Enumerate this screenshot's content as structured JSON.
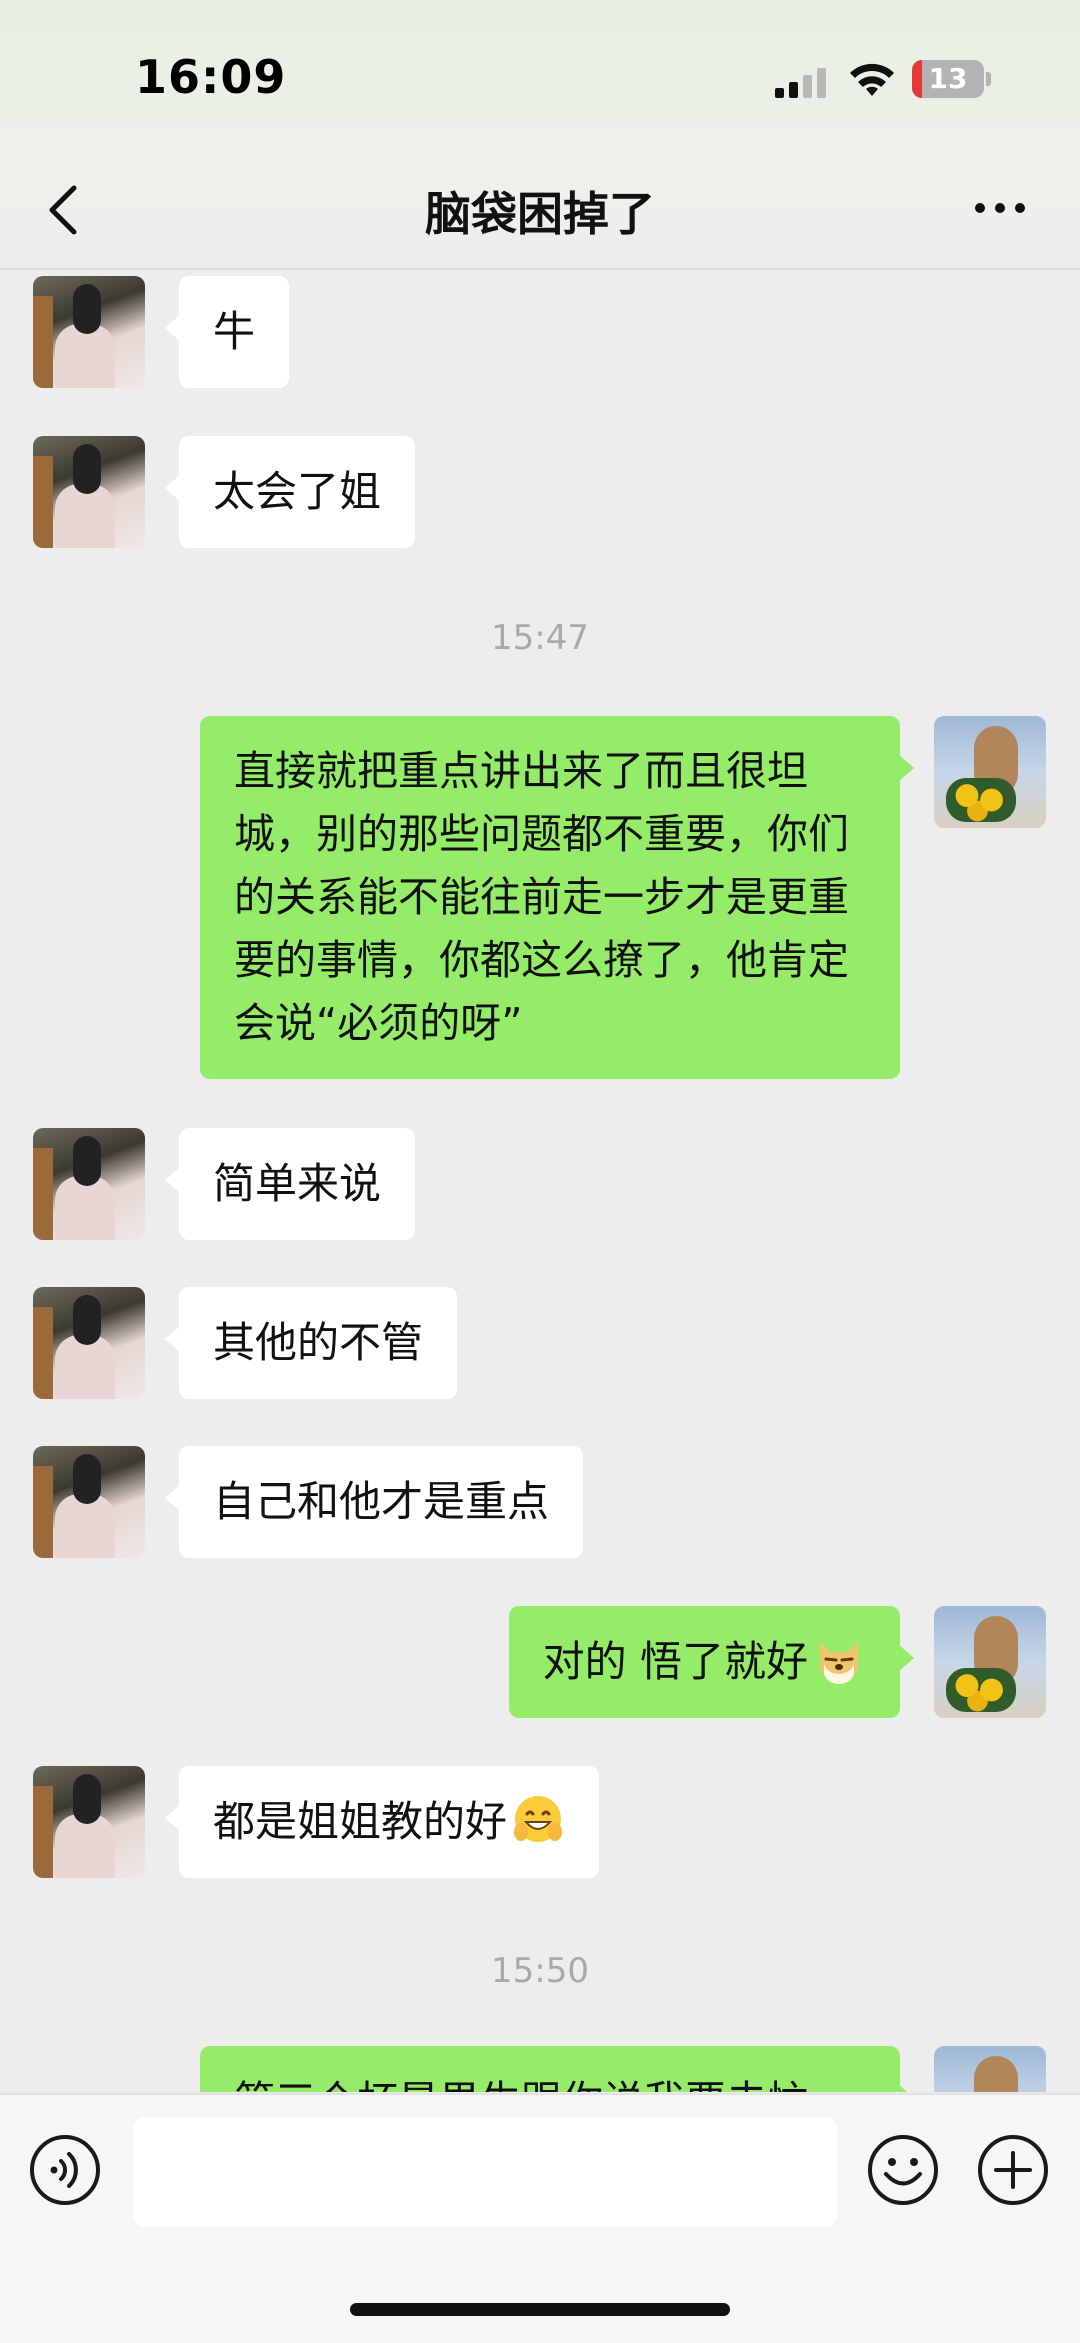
{
  "status_bar": {
    "time": "16:09",
    "battery_level": "13",
    "battery_color": "#e53935"
  },
  "header": {
    "title": "脑袋困掉了",
    "back_icon": "chevron-left-icon",
    "more_icon": "ellipsis-icon"
  },
  "messages": [
    {
      "side": "in",
      "text": "牛"
    },
    {
      "side": "in",
      "text": "太会了姐"
    },
    {
      "time": "15:47"
    },
    {
      "side": "out",
      "text": "直接就把重点讲出来了而且很坦城，别的那些问题都不重要，你们的关系能不能往前走一步才是更重要的事情，你都这么撩了，他肯定会说“必须的呀”"
    },
    {
      "side": "in",
      "text": "简单来说"
    },
    {
      "side": "in",
      "text": "其他的不管"
    },
    {
      "side": "in",
      "text": "自己和他才是重点"
    },
    {
      "side": "out",
      "text": "对的 悟了就好",
      "emoji": "doge-emoji"
    },
    {
      "side": "in",
      "text": "都是姐姐教的好",
      "emoji": "grin-emoji"
    },
    {
      "time": "15:50"
    },
    {
      "side": "out",
      "text": "第三个杯是男生跟你说我要去忙"
    }
  ],
  "input_bar": {
    "voice_icon": "voice-icon",
    "text_value": "",
    "emoji_icon": "smiley-icon",
    "plus_icon": "plus-icon"
  },
  "colors": {
    "outgoing_bubble": "#95ec69",
    "incoming_bubble": "#ffffff",
    "chat_background": "#ededed"
  }
}
